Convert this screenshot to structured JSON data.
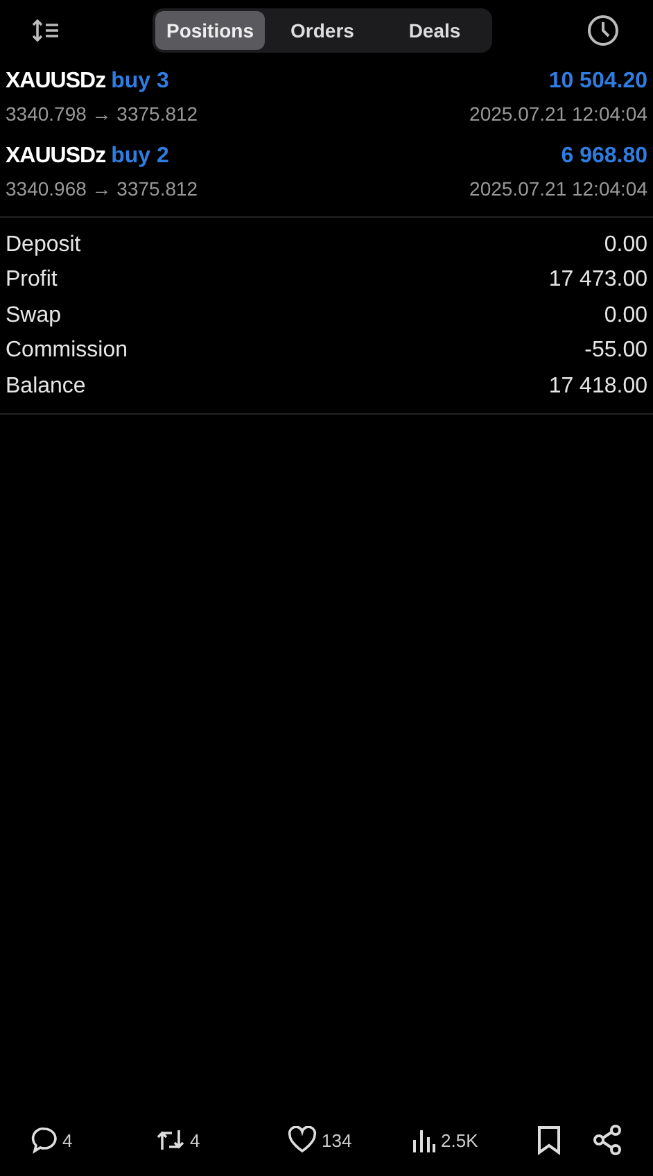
{
  "tabs": [
    {
      "label": "Positions",
      "selected": true
    },
    {
      "label": "Orders",
      "selected": false
    },
    {
      "label": "Deals",
      "selected": false
    }
  ],
  "positions": [
    {
      "symbol": "XAUUSDz",
      "type": "buy 3",
      "profit": "10 504.20",
      "prices": "3340.798 → 3375.812",
      "time": "2025.07.21 12:04:04"
    },
    {
      "symbol": "XAUUSDz",
      "type": "buy 2",
      "profit": "6 968.80",
      "prices": "3340.968 → 3375.812",
      "time": "2025.07.21 12:04:04"
    }
  ],
  "summary": [
    {
      "label": "Deposit",
      "value": "0.00"
    },
    {
      "label": "Profit",
      "value": "17 473.00"
    },
    {
      "label": "Swap",
      "value": "0.00"
    },
    {
      "label": "Commission",
      "value": "-55.00"
    },
    {
      "label": "Balance",
      "value": "17 418.00"
    }
  ],
  "actions": [
    {
      "kind": "reply",
      "count": "4"
    },
    {
      "kind": "repost",
      "count": "4"
    },
    {
      "kind": "like",
      "count": "134"
    },
    {
      "kind": "views",
      "count": "2.5K"
    },
    {
      "kind": "bookmark"
    },
    {
      "kind": "share"
    }
  ]
}
